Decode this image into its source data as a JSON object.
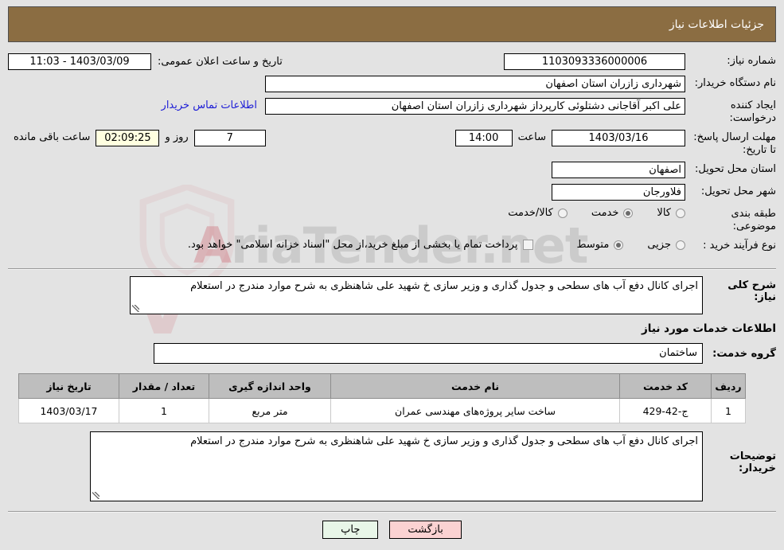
{
  "header": {
    "title": "جزئیات اطلاعات نیاز"
  },
  "form": {
    "need_number_label": "شماره نیاز:",
    "need_number_value": "1103093336000006",
    "announce_label": "تاریخ و ساعت اعلان عمومی:",
    "announce_value": "1403/03/09 - 11:03",
    "buyer_org_label": "نام دستگاه خریدار:",
    "buyer_org_value": "شهرداری زازران استان اصفهان",
    "creator_label": "ایجاد کننده درخواست:",
    "creator_value": "علی اکبر آقاجانی دشتلوئی کارپرداز شهرداری زازران استان اصفهان",
    "contact_link": "اطلاعات تماس خریدار",
    "deadline_label": "مهلت ارسال پاسخ: تا تاریخ:",
    "deadline_date": "1403/03/16",
    "hour_label": "ساعت",
    "deadline_time": "14:00",
    "days_value": "7",
    "days_label": "روز و",
    "remaining_clock": "02:09:25",
    "remaining_label": "ساعت باقی مانده",
    "province_label": "استان محل تحویل:",
    "province_value": "اصفهان",
    "city_label": "شهر محل تحویل:",
    "city_value": "فلاورجان",
    "category_label": "طبقه بندی موضوعی:",
    "category_options": [
      {
        "label": "کالا",
        "selected": false
      },
      {
        "label": "خدمت",
        "selected": true
      },
      {
        "label": "کالا/خدمت",
        "selected": false
      }
    ],
    "process_label": "نوع فرآیند خرید :",
    "process_options": [
      {
        "label": "جزیی",
        "selected": false
      },
      {
        "label": "متوسط",
        "selected": true
      }
    ],
    "treasury_checkbox_label": "پرداخت تمام یا بخشی از مبلغ خرید،از محل \"اسناد خزانه اسلامی\" خواهد بود.",
    "treasury_checked": false
  },
  "need_summary": {
    "label": "شرح کلی نیاز:",
    "value": "اجرای کانال دفع آب های سطحی و جدول گذاری و وزیر سازی خ شهید علی شاهنظری به شرح موارد مندرج در استعلام"
  },
  "services": {
    "section_title": "اطلاعات خدمات مورد نیاز",
    "group_label": "گروه خدمت:",
    "group_value": "ساختمان",
    "columns": [
      "ردیف",
      "کد خدمت",
      "نام خدمت",
      "واحد اندازه گیری",
      "تعداد / مقدار",
      "تاریخ نیاز"
    ],
    "rows": [
      {
        "radif": "1",
        "code": "ج-42-429",
        "name": "ساخت سایر پروژه‌های مهندسی عمران",
        "unit": "متر مربع",
        "qty": "1",
        "date": "1403/03/17"
      }
    ]
  },
  "buyer_notes": {
    "label": "توضیحات خریدار:",
    "value": "اجرای کانال دفع آب های سطحی و جدول گذاری و وزیر سازی خ شهید علی شاهنظری به شرح موارد مندرج در استعلام"
  },
  "footer": {
    "print_label": "چاپ",
    "back_label": "بازگشت"
  },
  "watermark": {
    "text_left": "Aria",
    "text_right": "Tender",
    "text_suffix": ".net"
  },
  "colors": {
    "header_bg": "#8b6d42",
    "table_header_bg": "#bebebe",
    "link": "#1d1dd6",
    "print_btn": "#e8f6e8",
    "back_btn": "#fbd2d2",
    "timer_bg": "#ffffe0",
    "page_bg": "#e3e3e3"
  }
}
